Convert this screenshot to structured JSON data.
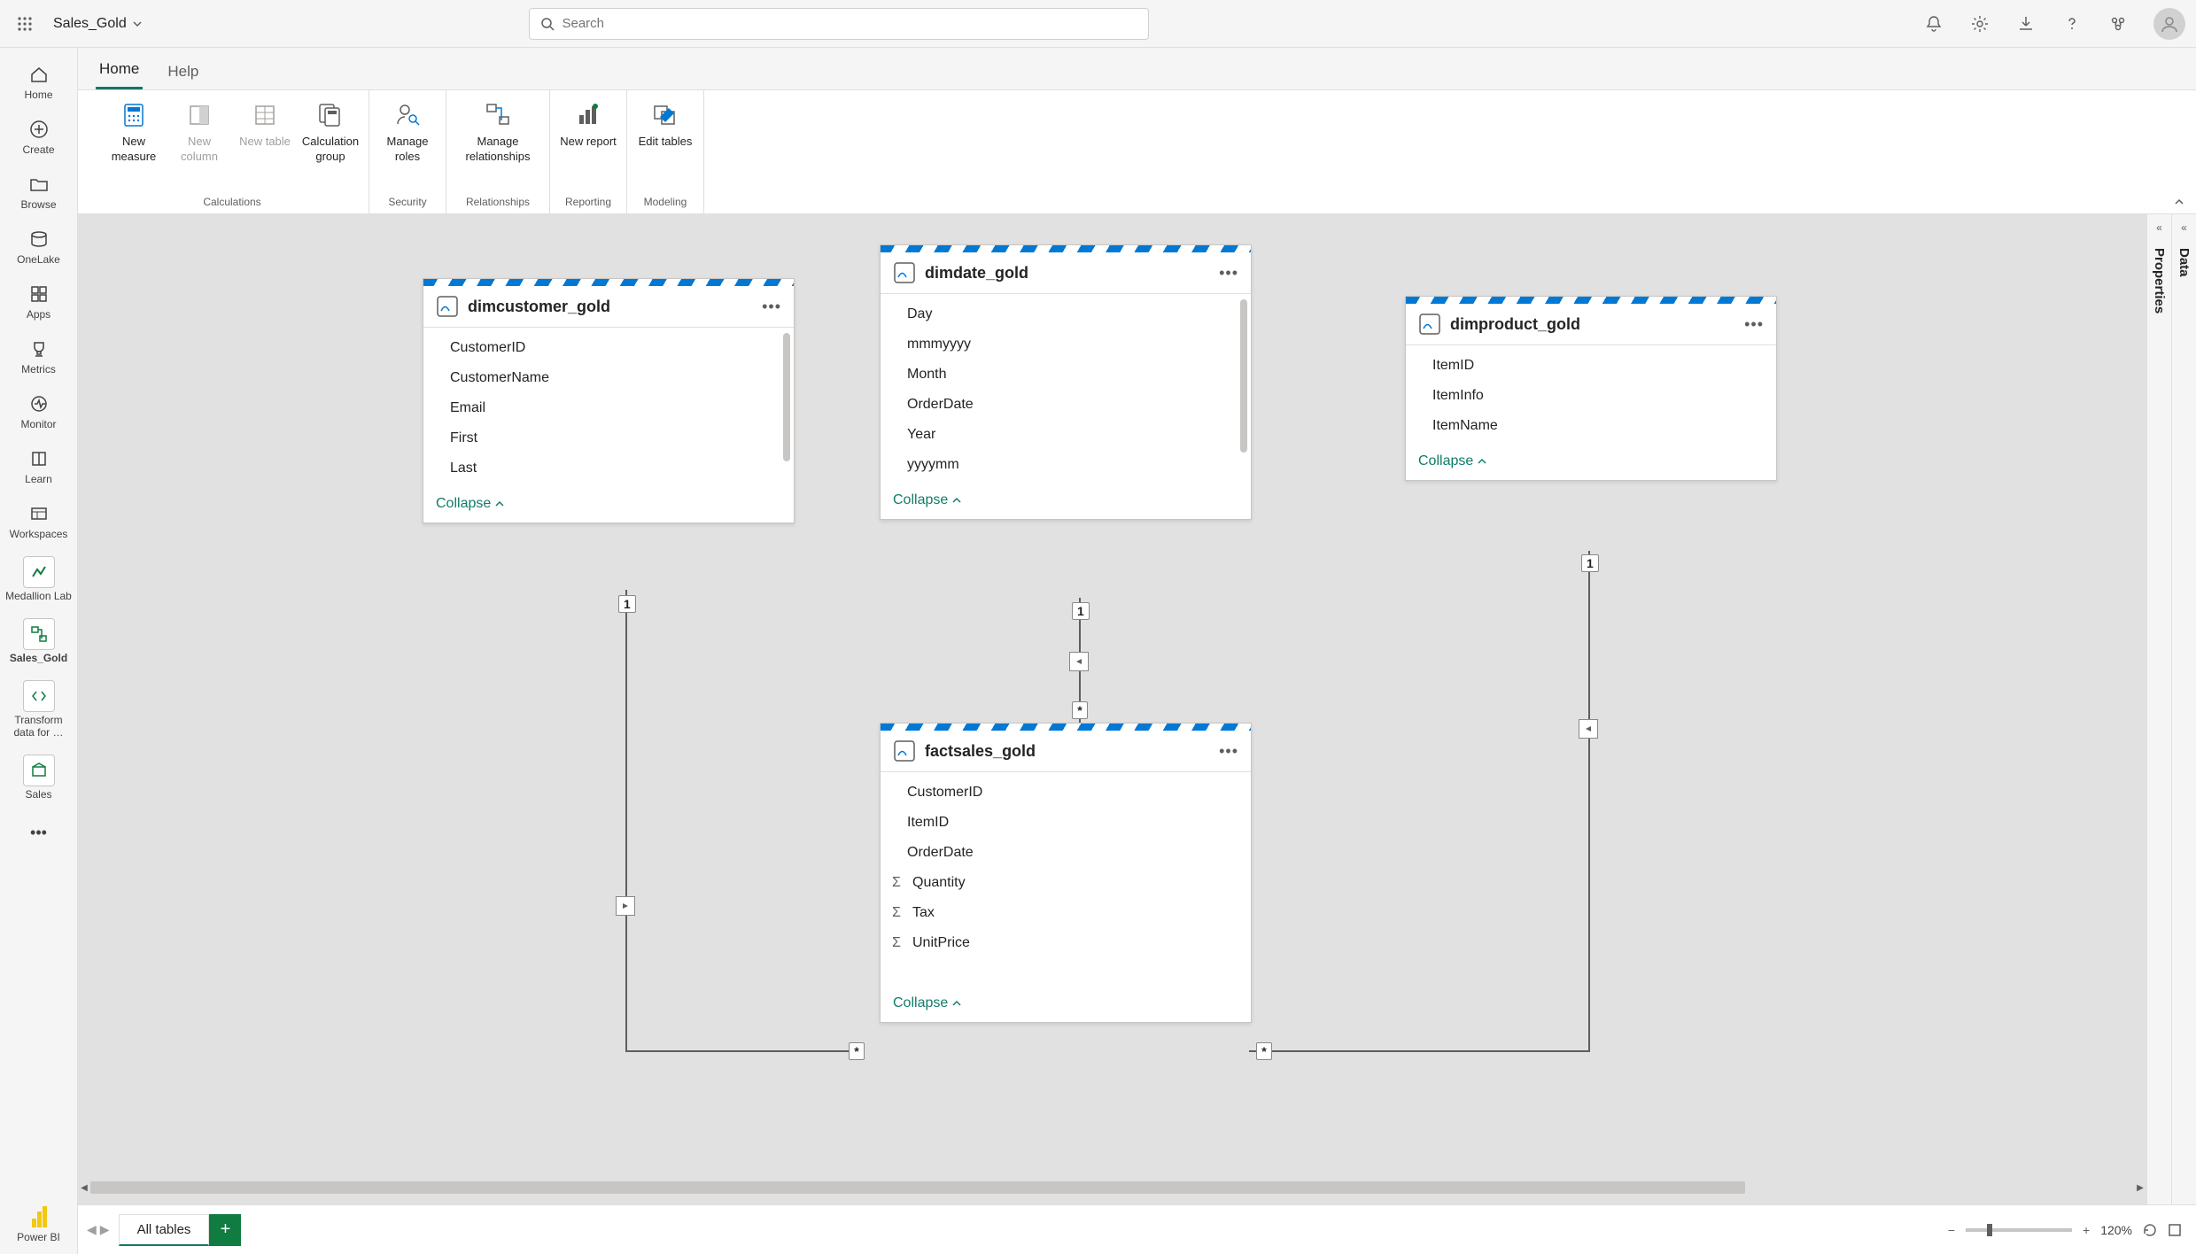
{
  "header": {
    "file_title": "Sales_Gold",
    "search_placeholder": "Search"
  },
  "tabs": {
    "home": "Home",
    "help": "Help"
  },
  "ribbon": {
    "calculations": {
      "new_measure": "New measure",
      "new_column": "New column",
      "new_table": "New table",
      "calc_group": "Calculation group",
      "label": "Calculations"
    },
    "security": {
      "manage_roles": "Manage roles",
      "label": "Security"
    },
    "relationships": {
      "manage_relationships": "Manage relationships",
      "label": "Relationships"
    },
    "reporting": {
      "new_report": "New report",
      "label": "Reporting"
    },
    "modeling": {
      "edit_tables": "Edit tables",
      "label": "Modeling"
    }
  },
  "leftrail": {
    "home": "Home",
    "create": "Create",
    "browse": "Browse",
    "onelake": "OneLake",
    "apps": "Apps",
    "metrics": "Metrics",
    "monitor": "Monitor",
    "learn": "Learn",
    "workspaces": "Workspaces",
    "medallion": "Medallion Lab",
    "sales_gold": "Sales_Gold",
    "transform": "Transform data for …",
    "sales": "Sales",
    "powerbi": "Power BI"
  },
  "tables": {
    "dimcustomer": {
      "name": "dimcustomer_gold",
      "cols": [
        "CustomerID",
        "CustomerName",
        "Email",
        "First",
        "Last"
      ],
      "collapse": "Collapse"
    },
    "dimdate": {
      "name": "dimdate_gold",
      "cols": [
        "Day",
        "mmmyyyy",
        "Month",
        "OrderDate",
        "Year",
        "yyyymm"
      ],
      "collapse": "Collapse"
    },
    "dimproduct": {
      "name": "dimproduct_gold",
      "cols": [
        "ItemID",
        "ItemInfo",
        "ItemName"
      ],
      "collapse": "Collapse"
    },
    "factsales": {
      "name": "factsales_gold",
      "cols": [
        "CustomerID",
        "ItemID",
        "OrderDate"
      ],
      "measures": [
        "Quantity",
        "Tax",
        "UnitPrice"
      ],
      "collapse": "Collapse"
    }
  },
  "cardinality": {
    "one": "1",
    "many": "*"
  },
  "rightpanels": {
    "properties": "Properties",
    "data": "Data"
  },
  "bottom": {
    "all_tables": "All tables"
  },
  "zoom": {
    "level": "120%"
  }
}
